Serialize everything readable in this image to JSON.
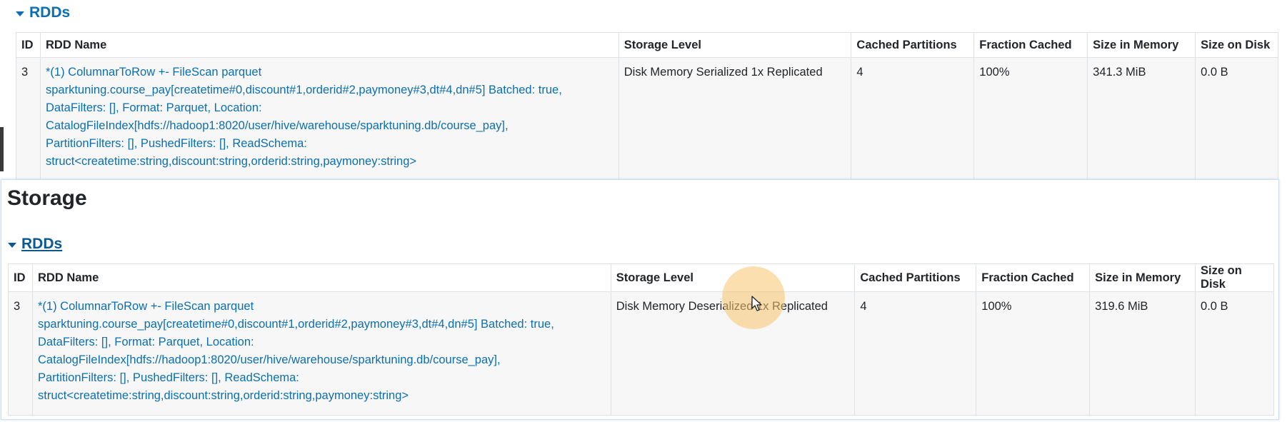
{
  "top_section": {
    "toggle_label": "RDDs",
    "headers": [
      "ID",
      "RDD Name",
      "Storage Level",
      "Cached Partitions",
      "Fraction Cached",
      "Size in Memory",
      "Size on Disk"
    ],
    "row": {
      "id": "3",
      "name_lines": [
        "*(1) ColumnarToRow +- FileScan parquet",
        "sparktuning.course_pay[createtime#0,discount#1,orderid#2,paymoney#3,dt#4,dn#5] Batched: true,",
        "DataFilters: [], Format: Parquet, Location:",
        "CatalogFileIndex[hdfs://hadoop1:8020/user/hive/warehouse/sparktuning.db/course_pay],",
        "PartitionFilters: [], PushedFilters: [], ReadSchema:",
        "struct<createtime:string,discount:string,orderid:string,paymoney:string>"
      ],
      "storage_level": "Disk Memory Serialized 1x Replicated",
      "cached_partitions": "4",
      "fraction_cached": "100%",
      "size_in_memory": "341.3 MiB",
      "size_on_disk": "0.0 B"
    }
  },
  "bottom_section": {
    "title": "Storage",
    "toggle_label": "RDDs",
    "headers": [
      "ID",
      "RDD Name",
      "Storage Level",
      "Cached Partitions",
      "Fraction Cached",
      "Size in Memory",
      "Size on Disk"
    ],
    "row": {
      "id": "3",
      "name_lines": [
        "*(1) ColumnarToRow +- FileScan parquet",
        "sparktuning.course_pay[createtime#0,discount#1,orderid#2,paymoney#3,dt#4,dn#5] Batched: true,",
        "DataFilters: [], Format: Parquet, Location:",
        "CatalogFileIndex[hdfs://hadoop1:8020/user/hive/warehouse/sparktuning.db/course_pay],",
        "PartitionFilters: [], PushedFilters: [], ReadSchema:",
        "struct<createtime:string,discount:string,orderid:string,paymoney:string>"
      ],
      "storage_level": "Disk Memory Deserialized 1x Replicated",
      "cached_partitions": "4",
      "fraction_cached": "100%",
      "size_in_memory": "319.6 MiB",
      "size_on_disk": "0.0 B"
    }
  },
  "colors": {
    "link": "#0b6fb0",
    "row_bg": "#f7f7f7",
    "border": "#dee2e6",
    "cursor_highlight": "#f7c46e"
  },
  "icons": [
    "caret-down-icon",
    "mouse-pointer-icon"
  ]
}
